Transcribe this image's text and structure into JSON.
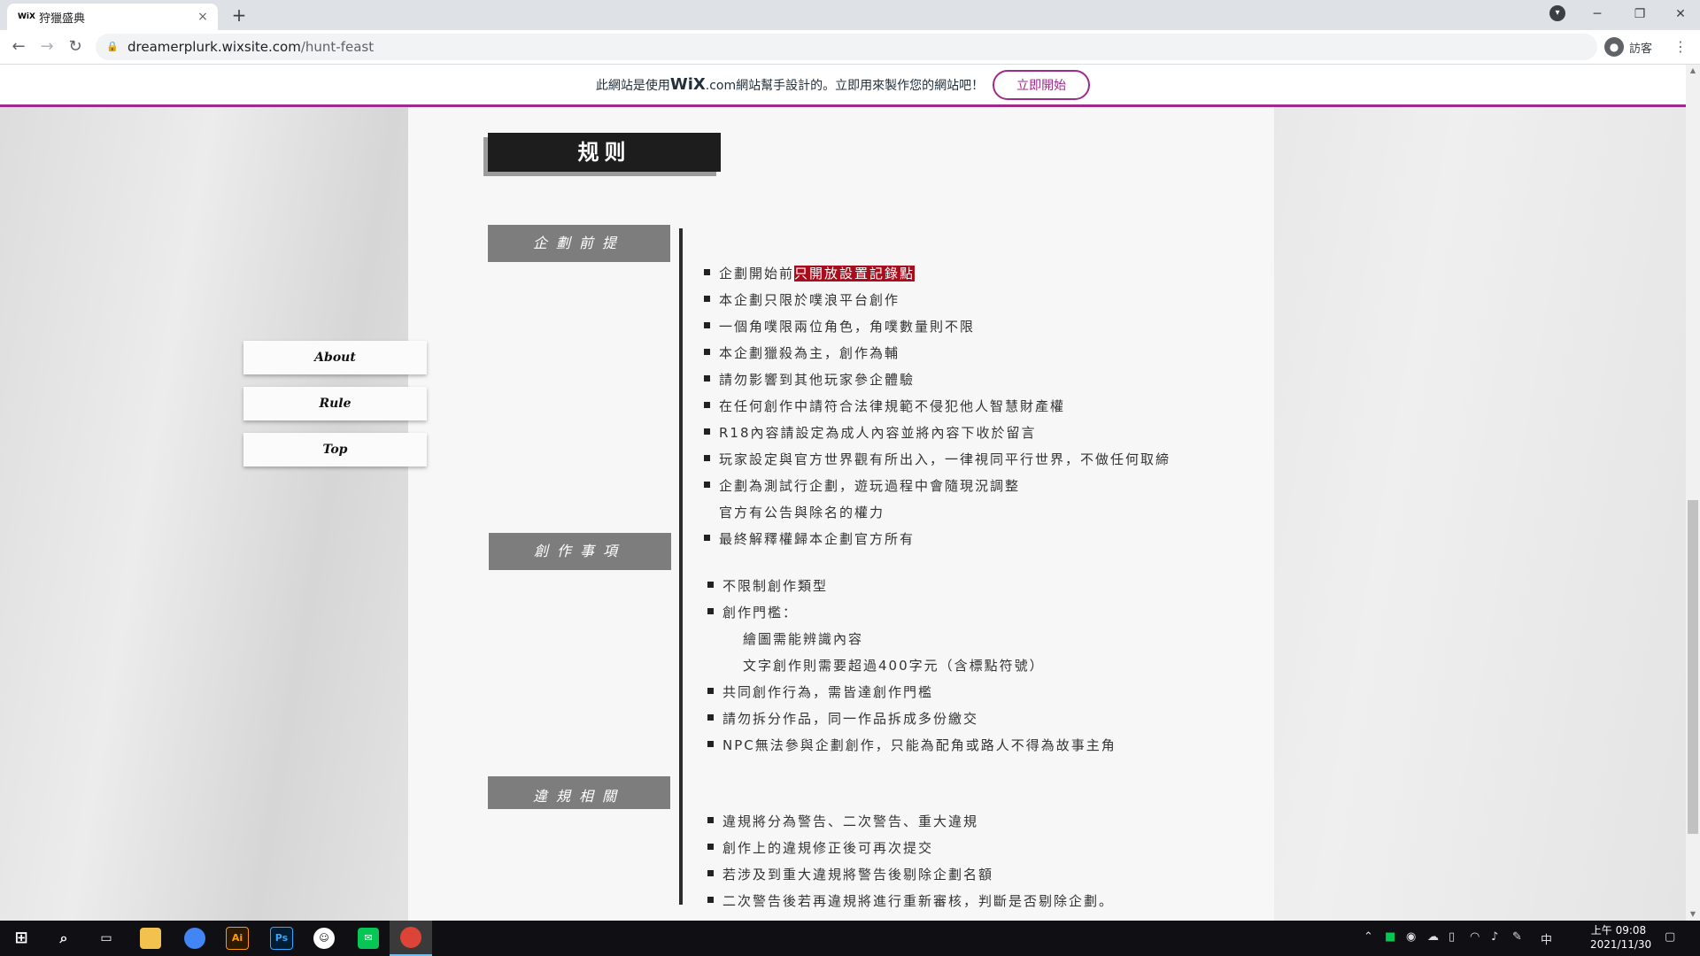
{
  "browser": {
    "tab_favicon": "WiX",
    "tab_title": "狩獵盛典",
    "tab_close": "×",
    "new_tab": "+",
    "url_domain": "dreamerplurk.wixsite.com",
    "url_path": "/hunt-feast",
    "profile_label": "訪客"
  },
  "wix_banner": {
    "text_prefix": "此網站是使用",
    "brand": "WiX",
    "brand_suffix": ".com",
    "text_suffix": "網站幫手設計的。立即用來製作您的網站吧！",
    "cta": "立即開始",
    "accent_color": "#9e2a8b"
  },
  "side_menu": [
    "About",
    "Rule",
    "Top"
  ],
  "page": {
    "title": "规则",
    "sections": [
      {
        "heading": "企劃前提"
      },
      {
        "heading": "創作事項"
      },
      {
        "heading": "違規相關"
      }
    ]
  },
  "premise": {
    "item1_prefix": "企劃開始前",
    "item1_highlight": "只開放設置記錄點",
    "items": [
      "本企劃只限於噗浪平台創作",
      "一個角噗限兩位角色，角噗數量則不限",
      "本企劃獵殺為主，創作為輔",
      "請勿影響到其他玩家參企體驗",
      "在任何創作中請符合法律規範不侵犯他人智慧財產權",
      "R18內容請設定為成人內容並將內容下收於留言",
      "玩家設定與官方世界觀有所出入，一律視同平行世界，不做任何取締",
      "企劃為測試行企劃，遊玩過程中會隨現況調整"
    ],
    "continuation": "官方有公告與除名的權力",
    "last": "最終解釋權歸本企劃官方所有"
  },
  "creation": {
    "item1": "不限制創作類型",
    "item2": "創作門檻：",
    "sub1": "繪圖需能辨識內容",
    "sub2": "文字創作則需要超過400字元（含標點符號）",
    "item3": "共同創作行為，需皆達創作門檻",
    "item4": "請勿拆分作品，同一作品拆成多份繳交",
    "item5": "NPC無法參與企劃創作，只能為配角或路人不得為故事主角"
  },
  "violation": {
    "items": [
      "違規將分為警告、二次警告、重大違規",
      "創作上的違規修正後可再次提交",
      "若涉及到重大違規將警告後剔除企劃名額",
      "二次警告後若再違規將進行重新審核，判斷是否剔除企劃。"
    ]
  },
  "taskbar": {
    "apps": [
      "windows-start",
      "search",
      "task-view",
      "file-explorer",
      "chrome-profile",
      "illustrator",
      "photoshop",
      "plurk",
      "line",
      "chrome"
    ],
    "ai_label": "Ai",
    "ps_label": "Ps",
    "ime": "中",
    "time": "上午 09:08",
    "date": "2021/11/30"
  }
}
